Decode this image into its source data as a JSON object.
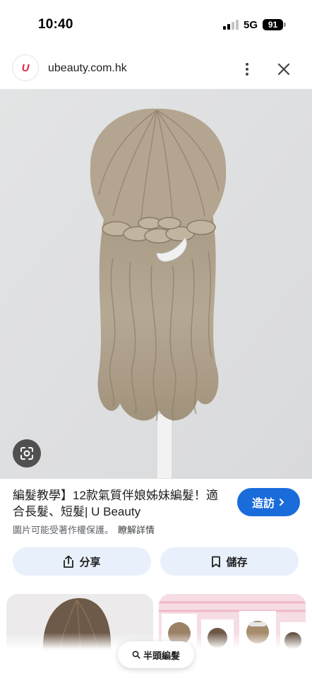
{
  "status_bar": {
    "time": "10:40",
    "network": "5G",
    "battery": "91"
  },
  "header": {
    "domain": "ubeauty.com.hk",
    "logo_text": "U"
  },
  "result": {
    "title": "編髮教學】12款氣質伴娘姊妹編髮！適合長髮、短髮| U Beauty",
    "visit_label": "造訪",
    "copyright_note": "圖片可能受著作權保護。",
    "learn_more": "瞭解詳情"
  },
  "actions": {
    "share_label": "分享",
    "save_label": "儲存"
  },
  "search_chip": {
    "label": "半頭編髮"
  },
  "icons": {
    "menu": "more-vert-icon",
    "close": "close-icon",
    "lens": "lens-icon",
    "share": "share-icon",
    "save": "bookmark-icon",
    "search": "search-icon",
    "visit": "chevron-right-icon"
  },
  "colors": {
    "accent": "#1a6cdb",
    "action_bg": "#e8f0fb",
    "logo": "#e0264a"
  }
}
